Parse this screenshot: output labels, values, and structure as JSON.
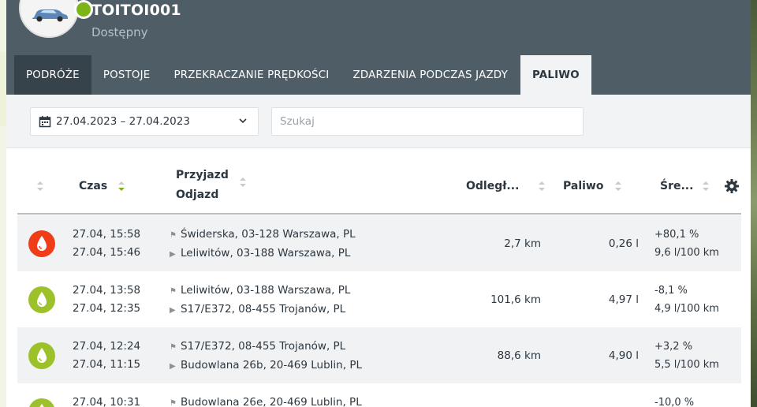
{
  "vehicle": {
    "name": "TOITOI001",
    "status": "Dostępny",
    "status_color": "#7cb518"
  },
  "tabs": [
    {
      "label": "PODRÓŻE",
      "active": false
    },
    {
      "label": "POSTOJE",
      "active": false
    },
    {
      "label": "PRZEKRACZANIE PRĘDKOŚCI",
      "active": false
    },
    {
      "label": "ZDARZENIA PODCZAS JAZDY",
      "active": false
    },
    {
      "label": "PALIWO",
      "active": true
    }
  ],
  "filters": {
    "date_range": "27.04.2023 – 27.04.2023",
    "search_placeholder": "Szukaj"
  },
  "table": {
    "headers": {
      "time": "Czas",
      "arrival": "Przyjazd",
      "departure": "Odjazd",
      "distance": "Odległ...",
      "fuel": "Paliwo",
      "average": "Śre..."
    },
    "rows": [
      {
        "icon": "fuel-drop-red-icon",
        "icon_color": "#ef3d1a",
        "arrival_time": "27.04, 15:58",
        "departure_time": "27.04, 15:46",
        "arrival_address": "Świderska, 03-128 Warszawa, PL",
        "departure_address": "Leliwitów, 03-188 Warszawa, PL",
        "distance": "2,7 km",
        "fuel": "0,26 l",
        "avg_diff": "+80,1 %",
        "avg_consumption": "9,6 l/100 km"
      },
      {
        "icon": "fuel-drop-green-icon",
        "icon_color": "#9cc12b",
        "arrival_time": "27.04, 13:58",
        "departure_time": "27.04, 12:35",
        "arrival_address": "Leliwitów, 03-188 Warszawa, PL",
        "departure_address": "S17/E372, 08-455 Trojanów, PL",
        "distance": "101,6 km",
        "fuel": "4,97 l",
        "avg_diff": "-8,1 %",
        "avg_consumption": "4,9 l/100 km"
      },
      {
        "icon": "fuel-drop-green-icon",
        "icon_color": "#9cc12b",
        "arrival_time": "27.04, 12:24",
        "departure_time": "27.04, 11:15",
        "arrival_address": "S17/E372, 08-455 Trojanów, PL",
        "departure_address": "Budowlana 26b, 20-469 Lublin, PL",
        "distance": "88,6 km",
        "fuel": "4,90 l",
        "avg_diff": "+3,2 %",
        "avg_consumption": "5,5 l/100 km"
      },
      {
        "icon": "fuel-drop-green-icon",
        "icon_color": "#9cc12b",
        "arrival_time": "27.04, 10:31",
        "departure_time": "",
        "arrival_address": "Budowlana 26e, 20-469 Lublin, PL",
        "departure_address": "",
        "distance": "",
        "fuel": "",
        "avg_diff": "-10,0 %",
        "avg_consumption": ""
      }
    ]
  }
}
